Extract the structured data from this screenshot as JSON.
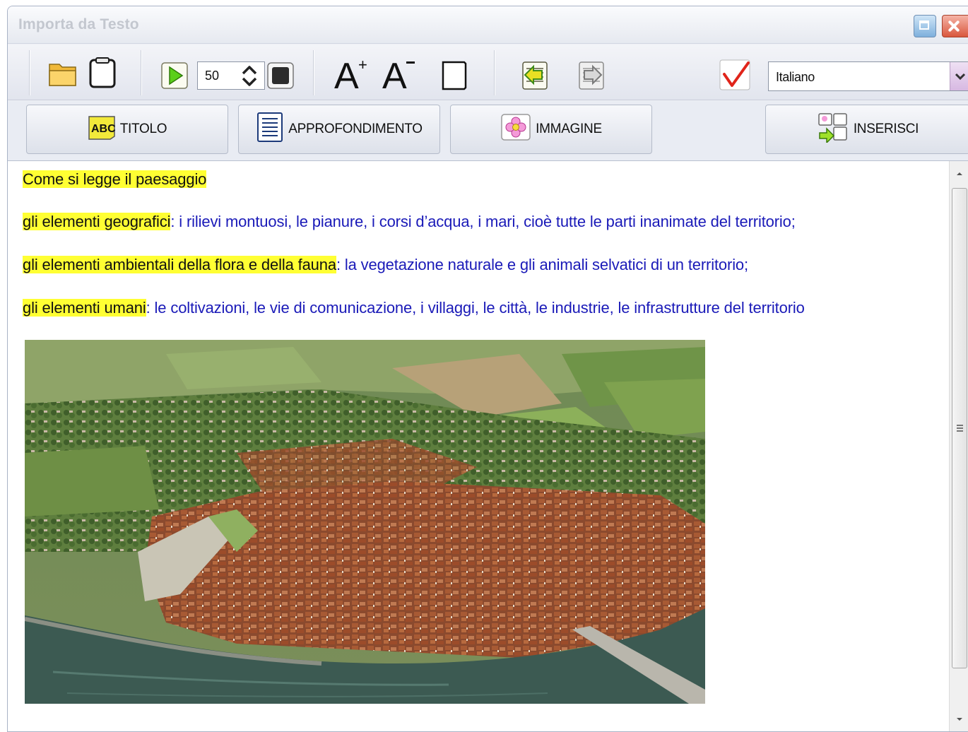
{
  "window": {
    "title": "Importa da Testo"
  },
  "toolbar": {
    "speed_value": "50",
    "language_selected": "Italiano",
    "font_bigger_label": "A+",
    "font_smaller_label": "A-"
  },
  "actions": {
    "titolo_label": "TITOLO",
    "titolo_icon_text": "ABC",
    "approfondimento_label": "APPROFONDIMENTO",
    "immagine_label": "IMMAGINE",
    "inserisci_label": "INSERISCI"
  },
  "content": {
    "heading": "Come si legge il paesaggio",
    "items": [
      {
        "term": " gli elementi geografici",
        "sep": ":",
        "desc": " i rilievi montuosi, le pianure, i corsi d’acqua, i mari, cioè tutte le parti inanimate del territorio;"
      },
      {
        "term": "gli elementi ambientali della flora e della fauna",
        "sep": ":",
        "desc": " la vegetazione naturale e gli animali selvatici di un territorio;"
      },
      {
        "term": " gli elementi umani",
        "sep": ":",
        "desc": " le coltivazioni, le vie di comunicazione, i villaggi, le città, le industrie, le infrastrutture del territorio"
      }
    ]
  },
  "colors": {
    "highlight": "#ffff33",
    "description_text": "#1a1ab8",
    "window_background": "#eef0f6"
  }
}
